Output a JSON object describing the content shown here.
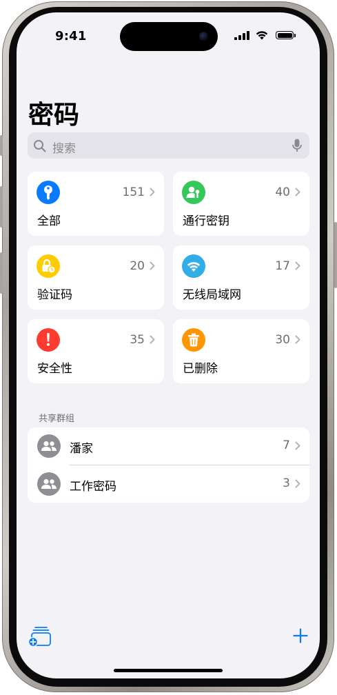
{
  "status_bar": {
    "time": "9:41"
  },
  "header": {
    "title": "密码"
  },
  "search": {
    "placeholder": "搜索"
  },
  "categories": [
    {
      "label": "全部",
      "count": "151",
      "icon": "key-icon",
      "color": "#0a7aff"
    },
    {
      "label": "通行密钥",
      "count": "40",
      "icon": "person-key-icon",
      "color": "#34c759"
    },
    {
      "label": "验证码",
      "count": "20",
      "icon": "lock-clock-icon",
      "color": "#ffcc00"
    },
    {
      "label": "无线局域网",
      "count": "17",
      "icon": "wifi-icon",
      "color": "#32ade6"
    },
    {
      "label": "安全性",
      "count": "35",
      "icon": "exclamation-icon",
      "color": "#ff3b30"
    },
    {
      "label": "已删除",
      "count": "30",
      "icon": "trash-icon",
      "color": "#ff9500"
    }
  ],
  "shared_groups": {
    "header": "共享群组",
    "items": [
      {
        "name": "潘家",
        "count": "7",
        "icon": "people-icon"
      },
      {
        "name": "工作密码",
        "count": "3",
        "icon": "people-icon"
      }
    ]
  },
  "toolbar": {
    "left_icon": "new-group-icon",
    "right_icon": "plus-icon",
    "accent": "#0a7aff"
  }
}
